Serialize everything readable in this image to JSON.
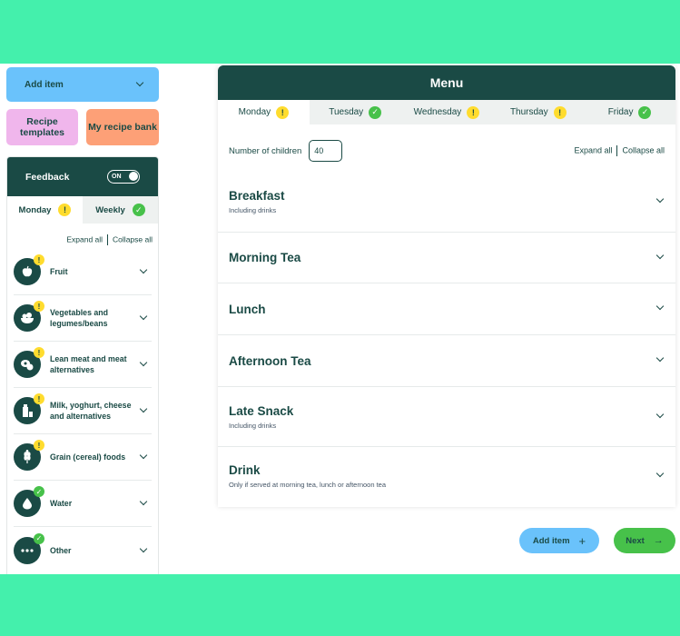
{
  "left": {
    "add_item": "Add item",
    "recipe_templates": "Recipe templates",
    "recipe_bank": "My recipe bank",
    "feedback": {
      "title": "Feedback",
      "toggle_label": "ON",
      "tabs": [
        {
          "label": "Monday",
          "status": "!"
        },
        {
          "label": "Weekly",
          "status": "✓"
        }
      ],
      "expand_all": "Expand all",
      "collapse_all": "Collapse all",
      "groups": [
        {
          "label": "Fruit",
          "status": "!",
          "icon": "apple-icon"
        },
        {
          "label": "Vegetables and legumes/beans",
          "status": "!",
          "icon": "vegetable-bowl-icon"
        },
        {
          "label": "Lean meat and meat alternatives",
          "status": "!",
          "icon": "meat-icon"
        },
        {
          "label": "Milk, yoghurt, cheese and alternatives",
          "status": "!",
          "icon": "milk-icon"
        },
        {
          "label": "Grain (cereal) foods",
          "status": "!",
          "icon": "wheat-icon"
        },
        {
          "label": "Water",
          "status": "✓",
          "icon": "water-drop-icon"
        },
        {
          "label": "Other",
          "status": "✓",
          "icon": "more-icon"
        }
      ]
    }
  },
  "main": {
    "title": "Menu",
    "days": [
      {
        "label": "Monday",
        "status": "!"
      },
      {
        "label": "Tuesday",
        "status": "✓"
      },
      {
        "label": "Wednesday",
        "status": "!"
      },
      {
        "label": "Thursday",
        "status": "!"
      },
      {
        "label": "Friday",
        "status": "✓"
      }
    ],
    "children_label": "Number of children",
    "children_value": "40",
    "expand_all": "Expand all",
    "collapse_all": "Collapse all",
    "meals": [
      {
        "title": "Breakfast",
        "subtitle": "Including drinks"
      },
      {
        "title": "Morning Tea",
        "subtitle": ""
      },
      {
        "title": "Lunch",
        "subtitle": ""
      },
      {
        "title": "Afternoon Tea",
        "subtitle": ""
      },
      {
        "title": "Late Snack",
        "subtitle": "Including drinks"
      },
      {
        "title": "Drink",
        "subtitle": "Only if served at morning tea, lunch or afternoon tea"
      }
    ]
  },
  "footer": {
    "add_item": "Add item",
    "add_glyph": "+",
    "next": "Next",
    "next_glyph": "→"
  },
  "colors": {
    "background": "#44f0ac",
    "dark": "#1a4a45",
    "blue": "#6ac2fb",
    "pink": "#f0b6ec",
    "orange": "#fda077",
    "warn": "#ffdc2e",
    "ok": "#47c14a"
  }
}
